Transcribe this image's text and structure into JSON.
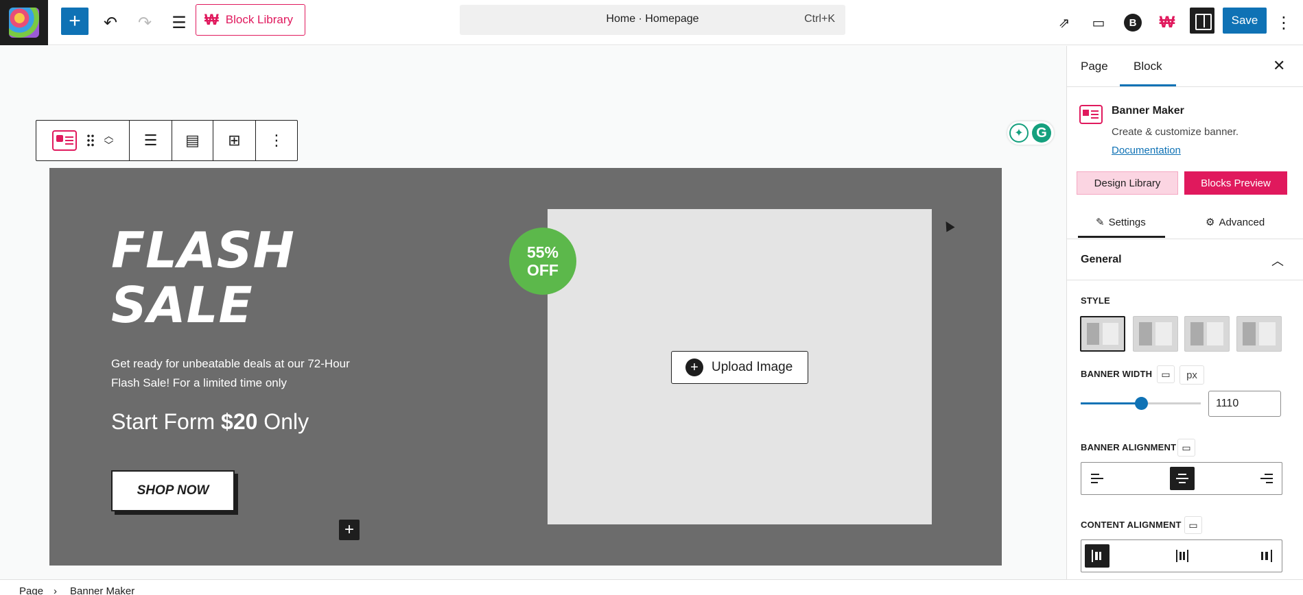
{
  "topbar": {
    "block_library_label": "Block Library",
    "command_bar_title": "Home · Homepage",
    "command_bar_shortcut": "Ctrl+K",
    "save_label": "Save",
    "brand_color": "#e0195d",
    "accent_color": "#0f72b5"
  },
  "canvas": {
    "banner": {
      "title_line1": "FLASH",
      "title_line2": "SALE",
      "description": "Get ready for unbeatable deals at our 72-Hour Flash Sale! For a limited time only",
      "price_prefix": "Start Form ",
      "price_value": "$20",
      "price_suffix": " Only",
      "button_label": "SHOP NOW",
      "badge_line1": "55%",
      "badge_line2": "OFF",
      "upload_label": "Upload Image",
      "background_color": "#6c6c6c",
      "badge_color": "#5cb84b"
    }
  },
  "sidebar": {
    "tabs": [
      "Page",
      "Block"
    ],
    "active_tab": "Block",
    "block_title": "Banner Maker",
    "block_description": "Create & customize banner.",
    "documentation_link": "Documentation",
    "design_library_label": "Design Library",
    "blocks_preview_label": "Blocks Preview",
    "settings_tabs": [
      "Settings",
      "Advanced"
    ],
    "general_label": "General",
    "style_label": "STYLE",
    "banner_width_label": "BANNER WIDTH",
    "banner_width_unit": "px",
    "banner_width_value": "1110",
    "banner_width_fraction": 0.5,
    "banner_alignment_label": "BANNER ALIGNMENT",
    "content_alignment_label": "CONTENT ALIGNMENT",
    "banner_alignment_selected": "center",
    "content_alignment_selected": "left"
  },
  "footer": {
    "breadcrumb_root": "Page",
    "breadcrumb_current": "Banner Maker"
  }
}
